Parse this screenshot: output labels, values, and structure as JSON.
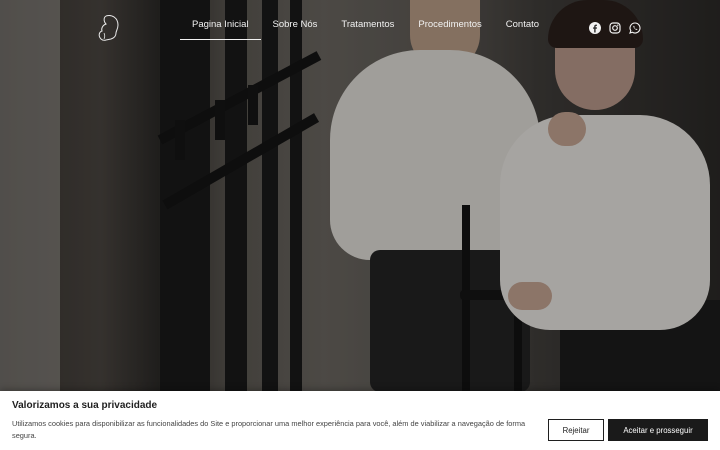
{
  "nav": {
    "items": [
      {
        "label": "Pagina Inicial",
        "active": true
      },
      {
        "label": "Sobre Nós"
      },
      {
        "label": "Tratamentos"
      },
      {
        "label": "Procedimentos"
      },
      {
        "label": "Contato"
      }
    ]
  },
  "header": {
    "logo_icon": "woman-profile-logo-icon",
    "social": [
      "facebook-icon",
      "instagram-icon",
      "whatsapp-icon"
    ]
  },
  "cookie_banner": {
    "title": "Valorizamos a sua privacidade",
    "text": "Utilizamos cookies para disponibilizar as funcionalidades do Site e proporcionar uma melhor experiência para você, além de viabilizar a navegação de forma segura.",
    "reject_label": "Rejeitar",
    "accept_label": "Aceitar e prosseguir"
  },
  "colors": {
    "nav_text": "#f2f2f2",
    "banner_bg": "#ffffff",
    "accept_bg": "#1a1a1a"
  }
}
